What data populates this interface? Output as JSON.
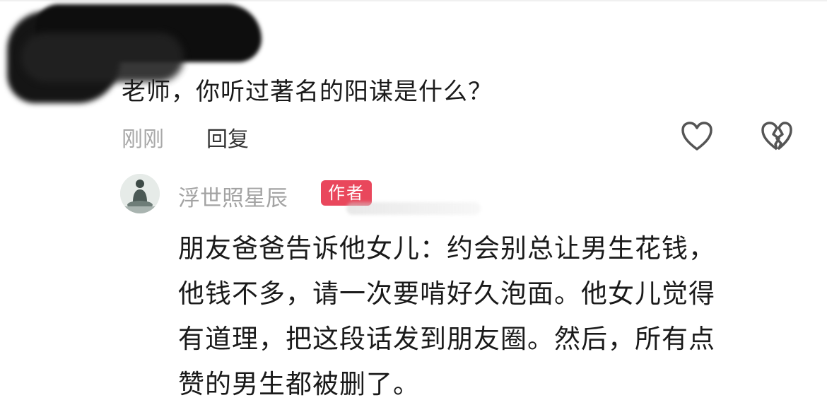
{
  "comment": {
    "text": "老师，你听过著名的阳谋是什么？",
    "time": "刚刚",
    "reply_label": "回复",
    "icons": {
      "like": "heart-outline-icon",
      "dislike": "broken-heart-icon"
    }
  },
  "reply": {
    "author": "浮世照星辰",
    "badge": "作者",
    "lines": [
      "朋友爸爸告诉他女儿：约会别总让男生花钱，",
      "他钱不多，请一次要啃好久泡面。他女儿觉得",
      "有道理，把这段话发到朋友圈。然后，所有点",
      "赞的男生都被删了。"
    ]
  },
  "colors": {
    "badge": "#e9475c",
    "muted": "#a8a8a8",
    "text": "#1a1a1a"
  }
}
